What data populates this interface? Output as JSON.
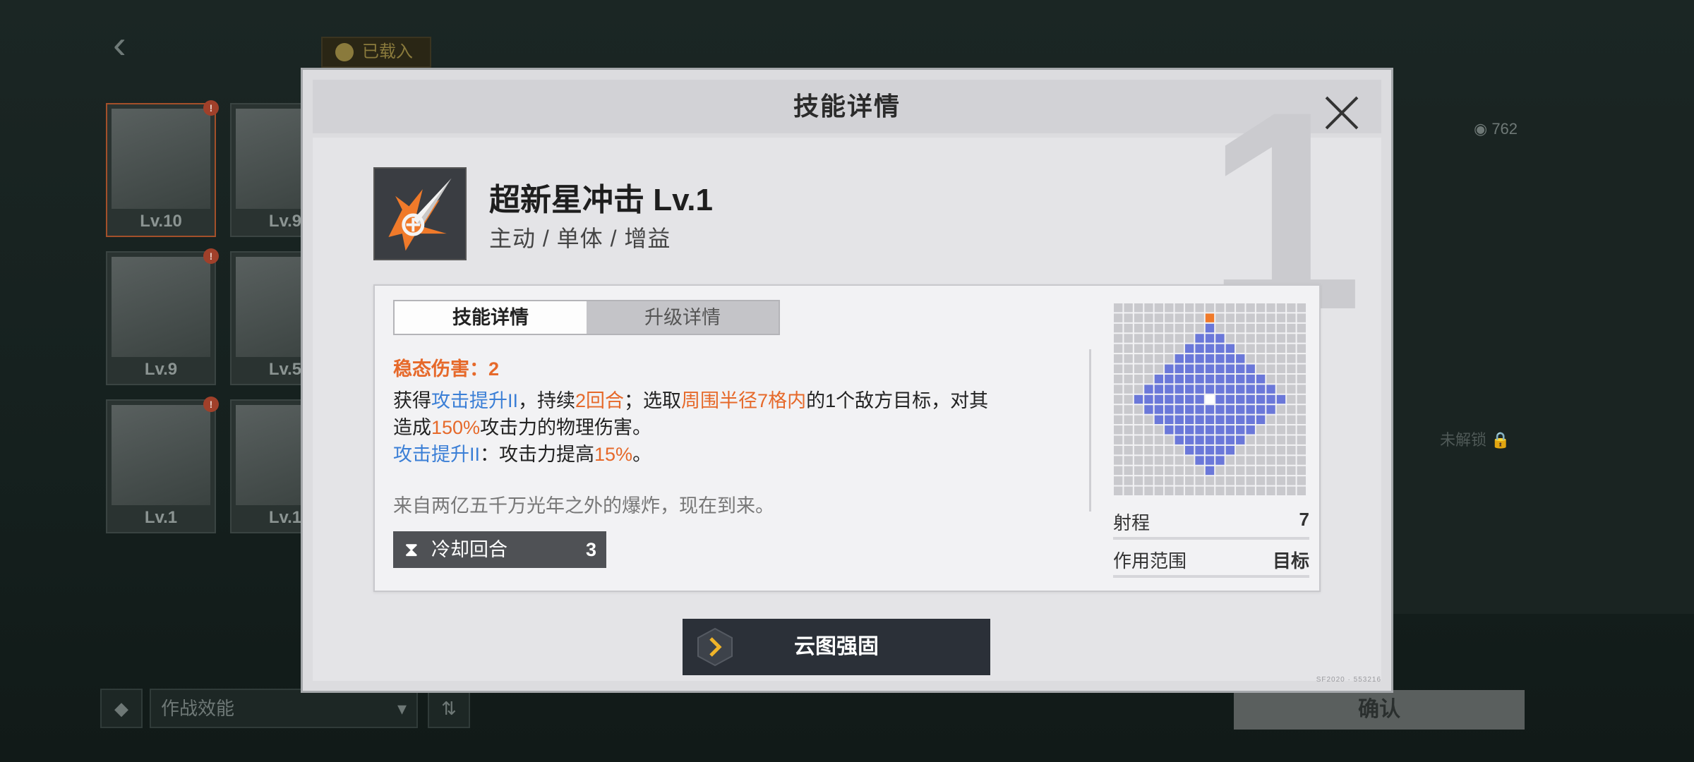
{
  "background": {
    "loaded_label": "已载入",
    "cards": [
      {
        "level": "Lv.10",
        "selected": true,
        "badge": "!"
      },
      {
        "level": "Lv.9",
        "selected": false,
        "badge": "!"
      },
      {
        "level": "Lv.9",
        "selected": false,
        "badge": "!"
      },
      {
        "level": "Lv.5",
        "selected": false,
        "badge": ""
      },
      {
        "level": "Lv.1",
        "selected": false,
        "badge": "!"
      },
      {
        "level": "Lv.1",
        "selected": false,
        "badge": "!"
      }
    ],
    "coins": "762",
    "unlock_label": "未解锁",
    "filter_label": "作战效能",
    "confirm_label": "确认"
  },
  "modal": {
    "title": "技能详情",
    "big_number": "1",
    "skill": {
      "name": "超新星冲击 Lv.1",
      "tags": "主动 / 单体 / 增益",
      "icon": "supernova-strike-icon"
    },
    "tabs": [
      {
        "label": "技能详情",
        "active": true
      },
      {
        "label": "升级详情",
        "active": false
      }
    ],
    "stable_damage": "稳态伤害：2",
    "description": {
      "l1": "获得",
      "l1_blue": "攻击提升II",
      "l1_b": "，持续",
      "l1_orange": "2回合",
      "l1_c": "；选取",
      "l1_orange2": "周围半径7格内",
      "l1_d": "的1个敌方目标，对其",
      "l2": "造成",
      "l2_orange": "150%",
      "l2_b": "攻击力的物理伤害。",
      "l3_blue": "攻击提升II",
      "l3": "：攻击力提高",
      "l3_orange": "15%",
      "l3_end": "。"
    },
    "flavor": "来自两亿五千万光年之外的爆炸，现在到来。",
    "cooldown": {
      "label": "冷却回合",
      "value": "3"
    },
    "range": {
      "label": "射程",
      "value": "7"
    },
    "area": {
      "label": "作用范围",
      "value": "目标"
    },
    "range_radius": 7,
    "colors": {
      "range": "#6b78d9",
      "center": "#ffffff",
      "target": "#f07a2a",
      "grid": "#c9c9cd"
    },
    "reinforce_label": "云图强固",
    "footer_code": "SF2020 · 553216"
  }
}
